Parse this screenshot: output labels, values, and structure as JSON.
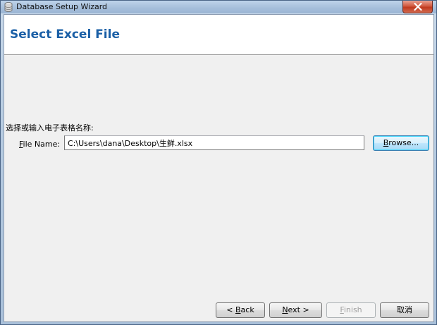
{
  "window": {
    "title": "Database Setup Wizard",
    "close_icon": "close-icon",
    "app_icon": "database-icon"
  },
  "header": {
    "title": "Select Excel File",
    "title_color": "#1a5fa6"
  },
  "form": {
    "prompt": "选择或输入电子表格名称:",
    "file_label_mnemonic": "F",
    "file_label_rest": "ile Name:",
    "file_value": "C:\\Users\\dana\\Desktop\\生鲜.xlsx",
    "browse_mnemonic": "B",
    "browse_rest": "rowse..."
  },
  "footer": {
    "back_prefix": "< ",
    "back_mnemonic": "B",
    "back_rest": "ack",
    "next_mnemonic": "N",
    "next_rest": "ext >",
    "finish_mnemonic": "F",
    "finish_rest": "inish",
    "finish_enabled": false,
    "cancel_label": "取消"
  }
}
